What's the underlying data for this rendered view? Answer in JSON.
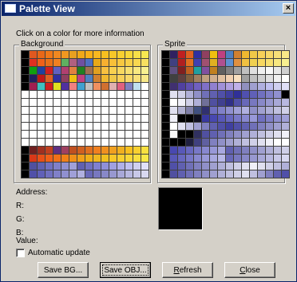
{
  "window": {
    "title": "Palette View",
    "close_glyph": "×"
  },
  "instruction": "Click on a color for more information",
  "groups": {
    "background": "Background",
    "sprite": "Sprite"
  },
  "info": {
    "address": "Address:",
    "r": "R:",
    "g": "G:",
    "b": "B:",
    "value": "Value:"
  },
  "preview_color": "#000000",
  "auto_update": {
    "label": "Automatic update",
    "checked": false
  },
  "buttons": {
    "save_bg": "Save BG...",
    "save_obj": "Save OBJ...",
    "refresh_mn": "R",
    "refresh_rest": "efresh",
    "close_mn": "C",
    "close_rest": "lose"
  },
  "icons": {
    "window": "window-icon",
    "close": "close-icon"
  },
  "background_palette": [
    [
      "#000000",
      "#e05820",
      "#e86818",
      "#f07818",
      "#f08820",
      "#f09820",
      "#e8a020",
      "#f0a818",
      "#f8b018",
      "#f8b820",
      "#f8c020",
      "#f8c828",
      "#f8d030",
      "#f8d838",
      "#f8e048",
      "#f8e850"
    ],
    [
      "#000000",
      "#e03020",
      "#f06018",
      "#e87018",
      "#f08020",
      "#60b060",
      "#b06080",
      "#7050a0",
      "#5070c0",
      "#e8a818",
      "#f8b030",
      "#f8c038",
      "#f8c840",
      "#f8d048",
      "#f8d850",
      "#f8e060"
    ],
    [
      "#000000",
      "#10a010",
      "#2040a0",
      "#d02020",
      "#6060c0",
      "#b04070",
      "#e08040",
      "#208020",
      "#a07050",
      "#e0a020",
      "#f8c040",
      "#f8d050",
      "#f8d860",
      "#f8e070",
      "#f8e880",
      "#f8f090"
    ],
    [
      "#000000",
      "#202060",
      "#c01818",
      "#e06020",
      "#3030a0",
      "#904060",
      "#f0c010",
      "#c04080",
      "#5080c0",
      "#d08030",
      "#f0b830",
      "#f0c848",
      "#f8d058",
      "#f8d868",
      "#f8e078",
      "#f8e888"
    ],
    [
      "#000000",
      "#a02050",
      "#40c0c0",
      "#d02020",
      "#e0e020",
      "#5030a0",
      "#f08080",
      "#40a0d0",
      "#c0c0c0",
      "#f09060",
      "#d07030",
      "#e0b0b0",
      "#e06080",
      "#8080c0",
      "#c0e0f0",
      "#ffffff"
    ],
    [
      "#ffffff",
      "#ffffff",
      "#ffffff",
      "#ffffff",
      "#ffffff",
      "#ffffff",
      "#ffffff",
      "#ffffff",
      "#ffffff",
      "#ffffff",
      "#ffffff",
      "#ffffff",
      "#ffffff",
      "#ffffff",
      "#ffffff",
      "#ffffff"
    ],
    [
      "#ffffff",
      "#ffffff",
      "#ffffff",
      "#ffffff",
      "#ffffff",
      "#ffffff",
      "#ffffff",
      "#ffffff",
      "#ffffff",
      "#ffffff",
      "#ffffff",
      "#ffffff",
      "#ffffff",
      "#ffffff",
      "#ffffff",
      "#ffffff"
    ],
    [
      "#ffffff",
      "#ffffff",
      "#ffffff",
      "#ffffff",
      "#ffffff",
      "#ffffff",
      "#ffffff",
      "#ffffff",
      "#ffffff",
      "#ffffff",
      "#ffffff",
      "#ffffff",
      "#ffffff",
      "#ffffff",
      "#ffffff",
      "#ffffff"
    ],
    [
      "#ffffff",
      "#ffffff",
      "#ffffff",
      "#ffffff",
      "#ffffff",
      "#ffffff",
      "#ffffff",
      "#ffffff",
      "#ffffff",
      "#ffffff",
      "#ffffff",
      "#ffffff",
      "#ffffff",
      "#ffffff",
      "#ffffff",
      "#ffffff"
    ],
    [
      "#ffffff",
      "#ffffff",
      "#ffffff",
      "#ffffff",
      "#ffffff",
      "#ffffff",
      "#ffffff",
      "#ffffff",
      "#ffffff",
      "#ffffff",
      "#ffffff",
      "#ffffff",
      "#ffffff",
      "#ffffff",
      "#ffffff",
      "#ffffff"
    ],
    [
      "#ffffff",
      "#ffffff",
      "#ffffff",
      "#ffffff",
      "#ffffff",
      "#ffffff",
      "#ffffff",
      "#ffffff",
      "#ffffff",
      "#ffffff",
      "#ffffff",
      "#ffffff",
      "#ffffff",
      "#ffffff",
      "#ffffff",
      "#ffffff"
    ],
    [
      "#ffffff",
      "#ffffff",
      "#ffffff",
      "#ffffff",
      "#ffffff",
      "#ffffff",
      "#ffffff",
      "#ffffff",
      "#ffffff",
      "#ffffff",
      "#ffffff",
      "#ffffff",
      "#ffffff",
      "#ffffff",
      "#ffffff",
      "#ffffff"
    ],
    [
      "#000000",
      "#702020",
      "#a03020",
      "#c04020",
      "#603080",
      "#a04060",
      "#c05020",
      "#d06020",
      "#e07020",
      "#f08020",
      "#f09020",
      "#f0a020",
      "#f0b020",
      "#f8c020",
      "#f8d030",
      "#f8e040"
    ],
    [
      "#000000",
      "#d83818",
      "#e85018",
      "#f06018",
      "#f07018",
      "#f08018",
      "#f09018",
      "#f0a018",
      "#f0b018",
      "#f0b820",
      "#f0c020",
      "#f8c828",
      "#f8d030",
      "#f8d838",
      "#f8e040",
      "#f8e848"
    ],
    [
      "#000000",
      "#5050a0",
      "#6060b0",
      "#7070c0",
      "#8080c8",
      "#9090d0",
      "#a0a0d8",
      "#6060b0",
      "#7070c0",
      "#8080d0",
      "#9090d8",
      "#a0a0e0",
      "#b0b0e8",
      "#c0c0f0",
      "#d0d0f0",
      "#e0e0f8"
    ],
    [
      "#000000",
      "#5050a8",
      "#6060b8",
      "#7070c0",
      "#8080c8",
      "#9090d0",
      "#a0a0d8",
      "#b0b0e0",
      "#6868b8",
      "#7878c0",
      "#8888c8",
      "#9898d0",
      "#a8a8d8",
      "#b8b8e0",
      "#c8c8e8",
      "#d8d8f0"
    ]
  ],
  "sprite_palette": [
    [
      "#000000",
      "#302060",
      "#c02020",
      "#e06020",
      "#3030a0",
      "#904060",
      "#f0c010",
      "#c04080",
      "#5080c0",
      "#d08030",
      "#f0b830",
      "#f0c848",
      "#f8d058",
      "#f8d868",
      "#f8e078",
      "#f8e888"
    ],
    [
      "#000000",
      "#404080",
      "#b02020",
      "#e07020",
      "#4040b0",
      "#a05070",
      "#e0b020",
      "#b05090",
      "#6090d0",
      "#e09040",
      "#f0c040",
      "#f0d050",
      "#f8d860",
      "#f8e070",
      "#f8e880",
      "#f8f090"
    ],
    [
      "#000000",
      "#605080",
      "#802020",
      "#c06020",
      "#20a0a0",
      "#8050a0",
      "#c08020",
      "#606060",
      "#808080",
      "#a0a0a0",
      "#c0c0c0",
      "#e0e0e0",
      "#f0f0f0",
      "#f8f8f8",
      "#e8e8e8",
      "#d0d0d0"
    ],
    [
      "#000000",
      "#404040",
      "#604040",
      "#806040",
      "#a08060",
      "#c0a080",
      "#d0b090",
      "#e0c0a0",
      "#f0d0b0",
      "#f8e0c0",
      "#a0a0a0",
      "#c0c0c0",
      "#d0d0d0",
      "#e0e0e0",
      "#f0f0f0",
      "#ffffff"
    ],
    [
      "#000000",
      "#403070",
      "#5040a0",
      "#6050b0",
      "#7060c0",
      "#8070c8",
      "#9080d0",
      "#a090d8",
      "#b0a0e0",
      "#c0b0e8",
      "#9090c0",
      "#a0a0d0",
      "#b0b0e0",
      "#c0c0f0",
      "#d0d0f0",
      "#e0e0f8"
    ],
    [
      "#000000",
      "#e0e0f0",
      "#d0d0e8",
      "#b0b0d8",
      "#9090c8",
      "#7070b8",
      "#6060b0",
      "#5050a8",
      "#4040a0",
      "#303098",
      "#5050b0",
      "#6060b8",
      "#7070c0",
      "#8080c8",
      "#9090d0",
      "#000000"
    ],
    [
      "#000000",
      "#ffffff",
      "#f0f0f8",
      "#d0d0e8",
      "#b0b0d8",
      "#707098",
      "#5050a0",
      "#404090",
      "#303088",
      "#5050a8",
      "#6868b8",
      "#7878c0",
      "#8888c8",
      "#9898d0",
      "#a8a8d8",
      "#b8b8e0"
    ],
    [
      "#000000",
      "#e0e0f0",
      "#b0b0d0",
      "#8080a8",
      "#405080",
      "#303070",
      "#7070c0",
      "#8080c8",
      "#9090d0",
      "#a0a0d8",
      "#b0b0e0",
      "#9090c8",
      "#a0a0d0",
      "#b0b0d8",
      "#c0c0e0",
      "#d0d0e8"
    ],
    [
      "#000000",
      "#f0f0f8",
      "#000000",
      "#000000",
      "#101020",
      "#3838a0",
      "#4848b0",
      "#5858b8",
      "#6868c0",
      "#7878c8",
      "#8888d0",
      "#9898d8",
      "#7070c0",
      "#8080c8",
      "#9090d0",
      "#a0a0d8"
    ],
    [
      "#000000",
      "#ffffff",
      "#e0e0f0",
      "#c0c0e0",
      "#a0a0d0",
      "#8080c0",
      "#6060b0",
      "#5050a8",
      "#4040a0",
      "#5050a8",
      "#6060b0",
      "#7070b8",
      "#8080c0",
      "#9090c8",
      "#a0a0d0",
      "#b0b0d8"
    ],
    [
      "#000000",
      "#f8f8f8",
      "#000000",
      "#000000",
      "#303060",
      "#5050a0",
      "#6060b0",
      "#7070b8",
      "#8080c0",
      "#9090c8",
      "#a0a0d0",
      "#b0b0d8",
      "#c0c0e0",
      "#d0d0e8",
      "#e0e0f0",
      "#f0f0f8"
    ],
    [
      "#000000",
      "#000000",
      "#000000",
      "#202040",
      "#404080",
      "#6060a0",
      "#8080c0",
      "#9090c8",
      "#a0a0d0",
      "#b0b0d8",
      "#c0c0e0",
      "#d0d0e8",
      "#e0e0f0",
      "#f0f0f8",
      "#ffffff",
      "#ffffff"
    ],
    [
      "#000000",
      "#4848b0",
      "#5858b8",
      "#6868c0",
      "#7878c8",
      "#8888d0",
      "#9898d8",
      "#a8a8e0",
      "#6060b0",
      "#7070b8",
      "#8080c0",
      "#9090c8",
      "#a0a0d0",
      "#b0b0d8",
      "#c0c0e0",
      "#d0d0e8"
    ],
    [
      "#000000",
      "#5858b8",
      "#6868c0",
      "#7878c8",
      "#8888d0",
      "#9898d8",
      "#a8a8e0",
      "#b8b8e8",
      "#6868b8",
      "#7878c0",
      "#8888c8",
      "#9898d0",
      "#a8a8d8",
      "#b8b8e0",
      "#c8c8e8",
      "#d8d8f0"
    ],
    [
      "#000000",
      "#5050a8",
      "#6060b0",
      "#7070b8",
      "#8080c0",
      "#9090c8",
      "#a0a0d0",
      "#b0b0d8",
      "#c0c0e0",
      "#d0d0e8",
      "#e0e0f0",
      "#f0f0f8",
      "#e0e0f0",
      "#d0d0e8",
      "#c0c0e0",
      "#b0b0d8"
    ],
    [
      "#000000",
      "#5050a0",
      "#6060b0",
      "#7070b8",
      "#8080c0",
      "#9090c8",
      "#a0a0d0",
      "#b0b0d8",
      "#c0c0e0",
      "#d0d0e8",
      "#e0e0f0",
      "#c0c0e0",
      "#a0a0d0",
      "#8080c0",
      "#6060b0",
      "#5050a8"
    ]
  ]
}
